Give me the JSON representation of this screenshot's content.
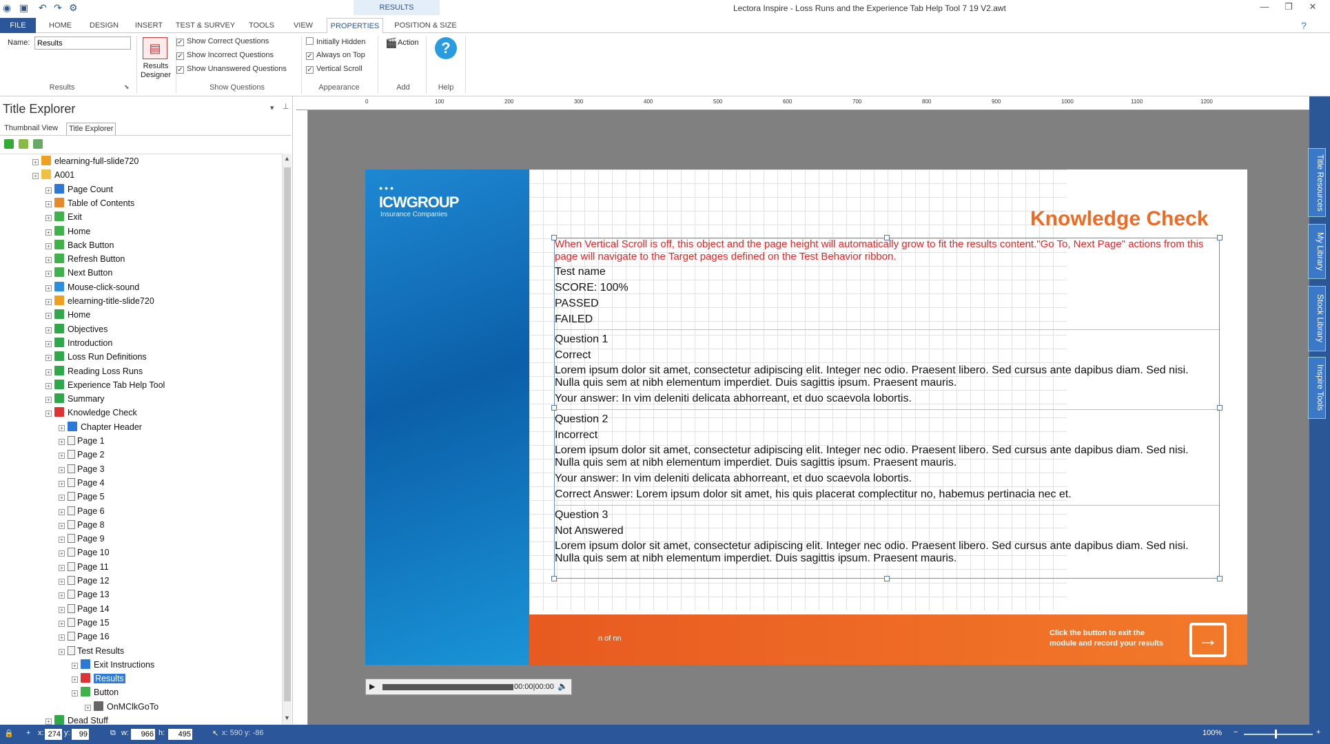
{
  "titlebar": {
    "context_tab": "RESULTS",
    "app_title": "Lectora Inspire - Loss Runs and the Experience Tab Help Tool 7 19 V2.awt"
  },
  "tabs": [
    "FILE",
    "HOME",
    "DESIGN",
    "INSERT",
    "TEST & SURVEY",
    "TOOLS",
    "VIEW",
    "PROPERTIES",
    "POSITION & SIZE"
  ],
  "ribbon": {
    "name_label": "Name:",
    "name_value": "Results",
    "results_designer_label": "Results Designer",
    "results_group": "Results",
    "show_correct": "Show Correct Questions",
    "show_incorrect": "Show Incorrect Questions",
    "show_unanswered": "Show Unanswered Questions",
    "show_questions_group": "Show Questions",
    "initially_hidden": "Initially Hidden",
    "always_on_top": "Always on Top",
    "vertical_scroll": "Vertical Scroll",
    "appearance_group": "Appearance",
    "action_label": "Action",
    "add_group": "Add",
    "help_group": "Help"
  },
  "explorer": {
    "title": "Title Explorer",
    "tab_thumbnail": "Thumbnail View",
    "tab_explorer": "Title Explorer",
    "tree": [
      {
        "label": "elearning-full-slide720",
        "indent": 1,
        "icon": "image-icon"
      },
      {
        "label": "A001",
        "indent": 1,
        "icon": "folder-icon"
      },
      {
        "label": "Page Count",
        "indent": 2,
        "icon": "text-icon"
      },
      {
        "label": "Table of Contents",
        "indent": 2,
        "icon": "toc-icon"
      },
      {
        "label": "Exit",
        "indent": 2,
        "icon": "button-icon"
      },
      {
        "label": "Home",
        "indent": 2,
        "icon": "button-icon"
      },
      {
        "label": "Back Button",
        "indent": 2,
        "icon": "button-icon"
      },
      {
        "label": "Refresh Button",
        "indent": 2,
        "icon": "button-icon"
      },
      {
        "label": "Next Button",
        "indent": 2,
        "icon": "button-icon"
      },
      {
        "label": "Mouse-click-sound",
        "indent": 2,
        "icon": "audio-icon"
      },
      {
        "label": "elearning-title-slide720",
        "indent": 2,
        "icon": "image-icon"
      },
      {
        "label": "Home",
        "indent": 2,
        "icon": "chapter-icon"
      },
      {
        "label": "Objectives",
        "indent": 2,
        "icon": "chapter-icon"
      },
      {
        "label": "Introduction",
        "indent": 2,
        "icon": "chapter-icon"
      },
      {
        "label": "Loss Run Definitions",
        "indent": 2,
        "icon": "chapter-icon"
      },
      {
        "label": "Reading Loss Runs",
        "indent": 2,
        "icon": "chapter-icon"
      },
      {
        "label": "Experience Tab Help Tool",
        "indent": 2,
        "icon": "chapter-icon"
      },
      {
        "label": "Summary",
        "indent": 2,
        "icon": "chapter-icon"
      },
      {
        "label": "Knowledge Check",
        "indent": 2,
        "icon": "test-icon"
      },
      {
        "label": "Chapter Header",
        "indent": 3,
        "icon": "text-icon"
      },
      {
        "label": "Page 1",
        "indent": 3,
        "icon": "page-icon"
      },
      {
        "label": "Page 2",
        "indent": 3,
        "icon": "page-icon"
      },
      {
        "label": "Page 3",
        "indent": 3,
        "icon": "page-icon"
      },
      {
        "label": "Page 4",
        "indent": 3,
        "icon": "page-icon"
      },
      {
        "label": "Page 5",
        "indent": 3,
        "icon": "page-icon"
      },
      {
        "label": "Page 6",
        "indent": 3,
        "icon": "page-icon"
      },
      {
        "label": "Page 8",
        "indent": 3,
        "icon": "page-icon"
      },
      {
        "label": "Page 9",
        "indent": 3,
        "icon": "page-icon"
      },
      {
        "label": "Page 10",
        "indent": 3,
        "icon": "page-icon"
      },
      {
        "label": "Page 11",
        "indent": 3,
        "icon": "page-icon"
      },
      {
        "label": "Page 12",
        "indent": 3,
        "icon": "page-icon"
      },
      {
        "label": "Page 13",
        "indent": 3,
        "icon": "page-icon"
      },
      {
        "label": "Page 14",
        "indent": 3,
        "icon": "page-icon"
      },
      {
        "label": "Page 15",
        "indent": 3,
        "icon": "page-icon"
      },
      {
        "label": "Page 16",
        "indent": 3,
        "icon": "page-icon"
      },
      {
        "label": "Test Results",
        "indent": 3,
        "icon": "page-icon"
      },
      {
        "label": "Exit Instructions",
        "indent": 4,
        "icon": "text-icon"
      },
      {
        "label": "Results",
        "indent": 4,
        "icon": "results-icon",
        "selected": true
      },
      {
        "label": "Button",
        "indent": 4,
        "icon": "button-icon"
      },
      {
        "label": "OnMClkGoTo",
        "indent": 5,
        "icon": "action-icon"
      },
      {
        "label": "Dead Stuff",
        "indent": 2,
        "icon": "chapter-icon"
      }
    ]
  },
  "slide": {
    "logo": "ICWGROUP",
    "logo_sub": "Insurance Companies",
    "heading": "Knowledge Check",
    "notice": "When Vertical Scroll is off, this object and the page height will automatically grow to fit the results content.\"Go To, Next Page\" actions from this page will navigate to the Target pages defined on the Test Behavior ribbon.",
    "test_name": "Test name",
    "score": "SCORE: 100%",
    "passed": "PASSED",
    "failed": "FAILED",
    "q1": "Question 1",
    "q1_status": "Correct",
    "lorem": "Lorem ipsum dolor sit amet, consectetur adipiscing elit. Integer nec odio. Praesent libero. Sed cursus ante dapibus diam. Sed nisi. Nulla quis sem at nibh elementum imperdiet. Duis sagittis ipsum. Praesent mauris.",
    "your_answer": "Your answer: In vim deleniti delicata abhorreant, et duo scaevola lobortis.",
    "q2": "Question 2",
    "q2_status": "Incorrect",
    "correct_answer": "Correct Answer: Lorem ipsum dolor sit amet, his quis placerat complectitur  no, habemus pertinacia nec et.",
    "q3": "Question 3",
    "q3_status": "Not Answered",
    "page_count": "n of nn",
    "exit_text": "Click the button to exit the module and record your results"
  },
  "media": {
    "time": "00:00|00:00"
  },
  "side_tabs": [
    "Title Resources",
    "My Library",
    "Stock Library",
    "Inspire Tools"
  ],
  "status": {
    "x": "274",
    "y": "99",
    "w": "966",
    "h": "495",
    "cursor": "x: 590  y: -86",
    "zoom": "100%"
  },
  "ruler_labels": [
    "0",
    "100",
    "200",
    "300",
    "400",
    "500",
    "600",
    "700",
    "800",
    "900",
    "1000",
    "1100",
    "1200"
  ]
}
